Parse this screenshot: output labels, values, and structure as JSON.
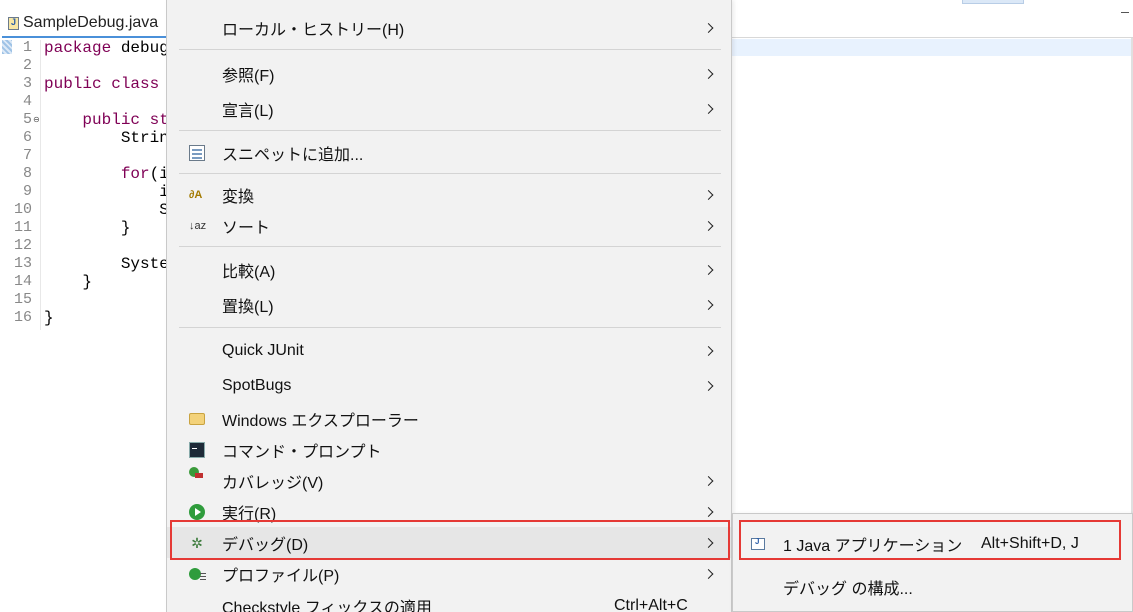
{
  "editor": {
    "tab_title": "SampleDebug.java",
    "line_numbers": [
      "1",
      "2",
      "3",
      "4",
      "5",
      "6",
      "7",
      "8",
      "9",
      "10",
      "11",
      "12",
      "13",
      "14",
      "15",
      "16"
    ],
    "code_lines": [
      {
        "n": 1,
        "kw": "package",
        "rest": " debug"
      },
      {
        "n": 3,
        "kw": "public class",
        "rest": ""
      },
      {
        "n": 5,
        "kw": "    public st",
        "rest": ""
      },
      {
        "n": 6,
        "kw": "",
        "rest": "        String"
      },
      {
        "n": 8,
        "kw": "        for",
        "rest": "(i"
      },
      {
        "n": 9,
        "kw": "",
        "rest": "            in"
      },
      {
        "n": 10,
        "kw": "",
        "rest": "            Sy"
      },
      {
        "n": 11,
        "kw": "",
        "rest": "        }"
      },
      {
        "n": 13,
        "kw": "",
        "rest": "        System"
      },
      {
        "n": 14,
        "kw": "",
        "rest": "    }"
      },
      {
        "n": 16,
        "kw": "",
        "rest": "}"
      }
    ]
  },
  "context_menu": {
    "items": [
      {
        "label": "ローカル・ヒストリー(H)",
        "icon": "",
        "submenu": true
      },
      {
        "label": "参照(F)",
        "icon": "",
        "submenu": true
      },
      {
        "label": "宣言(L)",
        "icon": "",
        "submenu": true
      },
      {
        "label": "スニペットに追加...",
        "icon": "snippet-icon",
        "submenu": false
      },
      {
        "label": "変換",
        "icon": "convert-icon",
        "submenu": true
      },
      {
        "label": "ソート",
        "icon": "sort-icon",
        "submenu": true
      },
      {
        "label": "比較(A)",
        "icon": "",
        "submenu": true
      },
      {
        "label": "置換(L)",
        "icon": "",
        "submenu": true
      },
      {
        "label": "Quick JUnit",
        "icon": "",
        "submenu": true
      },
      {
        "label": "SpotBugs",
        "icon": "",
        "submenu": true
      },
      {
        "label": "Windows エクスプローラー",
        "icon": "folder-icon",
        "submenu": false
      },
      {
        "label": "コマンド・プロンプト",
        "icon": "console-icon",
        "submenu": false
      },
      {
        "label": "カバレッジ(V)",
        "icon": "coverage-icon",
        "submenu": true
      },
      {
        "label": "実行(R)",
        "icon": "run-icon",
        "submenu": true
      },
      {
        "label": "デバッグ(D)",
        "icon": "debug-icon",
        "submenu": true,
        "selected": true
      },
      {
        "label": "プロファイル(P)",
        "icon": "profile-icon",
        "submenu": true
      },
      {
        "label": "Checkstyle フィックスの適用",
        "icon": "",
        "submenu": false,
        "shortcut": "Ctrl+Alt+C"
      }
    ],
    "icon_glyphs": {
      "convert": "∂A",
      "sort": "↓az",
      "debug": "✲"
    }
  },
  "debug_submenu": {
    "items": [
      {
        "label": "1 Java アプリケーション",
        "shortcut": "Alt+Shift+D, J",
        "icon": "java-app-icon"
      },
      {
        "label": "デバッグ の構成...",
        "shortcut": "",
        "icon": ""
      }
    ]
  },
  "highlight_color": "#e53935"
}
